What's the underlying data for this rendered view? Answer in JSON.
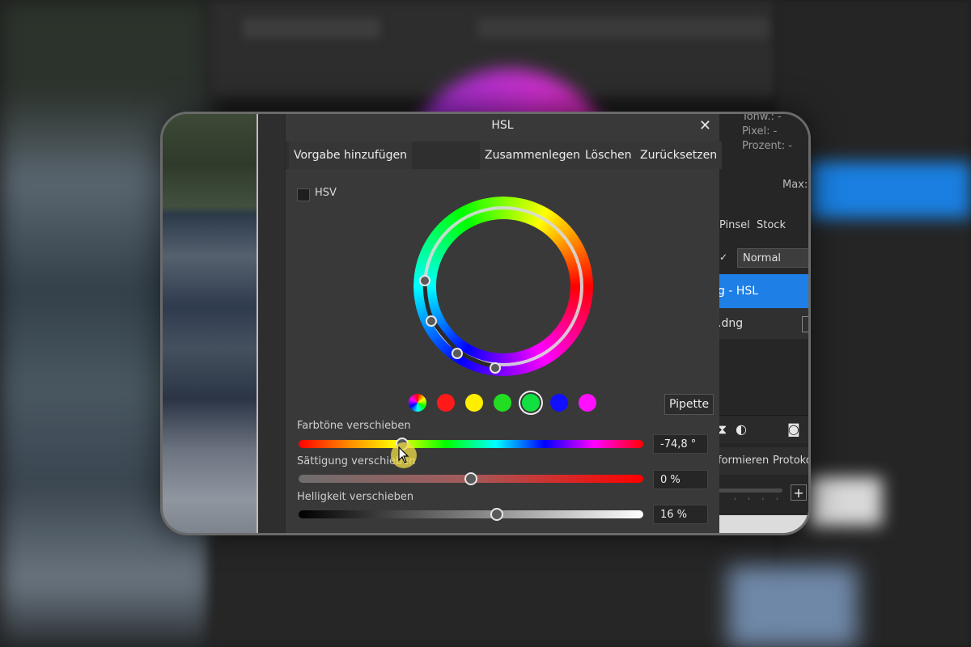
{
  "dialog": {
    "title": "HSL",
    "close_label": "✕",
    "toolbar": {
      "add_preset": "Vorgabe hinzufügen",
      "merge": "Zusammenlegen",
      "delete": "Löschen",
      "reset": "Zurücksetzen"
    },
    "hsv_label": "HSV",
    "hsv_checked": false,
    "swatches": [
      {
        "name": "master",
        "color": "multi"
      },
      {
        "name": "red",
        "color": "#ff1a1a"
      },
      {
        "name": "yellow",
        "color": "#ffee00"
      },
      {
        "name": "green",
        "color": "#22dd22"
      },
      {
        "name": "cyan-green",
        "color": "#11e040"
      },
      {
        "name": "blue",
        "color": "#1010ff"
      },
      {
        "name": "magenta",
        "color": "#ff10ff"
      }
    ],
    "selected_swatch": "cyan-green",
    "pipette_label": "Pipette",
    "sliders": {
      "hue": {
        "label": "Farbtöne verschieben",
        "value": "-74,8 °",
        "fraction": 0.3
      },
      "saturation": {
        "label": "Sättigung verschieben",
        "value": "0 %",
        "fraction": 0.5
      },
      "lightness": {
        "label": "Helligkeit verschieben",
        "value": "16 %",
        "fraction": 0.575
      }
    }
  },
  "right_panel": {
    "stats": [
      "Tonw.: -",
      "Pixel: -",
      "Prozent: -"
    ],
    "max_label": "Max:",
    "tabs": [
      "Pinsel",
      "Stock"
    ],
    "blend_mode": "Normal",
    "layers": [
      "g - HSL",
      ".dng"
    ],
    "bottom_tabs": [
      "formieren",
      "Protoko"
    ],
    "plus_label": "+"
  },
  "colors": {
    "dialog_bg": "#3a3939",
    "selected_layer": "#1e7fe6"
  }
}
